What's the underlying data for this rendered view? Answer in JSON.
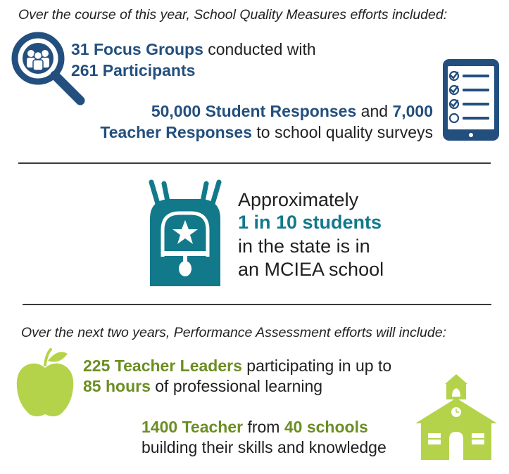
{
  "colors": {
    "navy": "#234f7e",
    "teal": "#12798b",
    "green": "#6b8e23",
    "lime": "#b5d34a"
  },
  "section1": {
    "heading": "Over the course of this year, School Quality Measures efforts included:",
    "focus_groups": {
      "value": "31 Focus Groups",
      "text": "conducted with"
    },
    "participants": {
      "value": "261 Participants"
    },
    "responses": {
      "student_value": "50,000 Student Responses",
      "and": "and",
      "teacher_count": "7,000",
      "teacher_value": "Teacher Responses",
      "text": "to school quality surveys"
    },
    "icons": [
      "magnifier-people-icon",
      "tablet-checklist-icon"
    ]
  },
  "section2": {
    "line1": "Approximately",
    "highlight": "1 in 10 students",
    "line3": "in the state is in",
    "line4": "an MCIEA school",
    "icons": [
      "backpack-icon"
    ]
  },
  "section3": {
    "heading": "Over the next two years, Performance Assessment efforts will include:",
    "leaders": {
      "value": "225 Teacher Leaders",
      "text": "participating in up to"
    },
    "hours": {
      "value": "85 hours",
      "text": "of professional learning"
    },
    "teachers": {
      "value": "1400 Teacher",
      "from": "from",
      "schools": "40 schools"
    },
    "skills": "building their skills and knowledge",
    "icons": [
      "apple-icon",
      "schoolhouse-icon"
    ]
  }
}
